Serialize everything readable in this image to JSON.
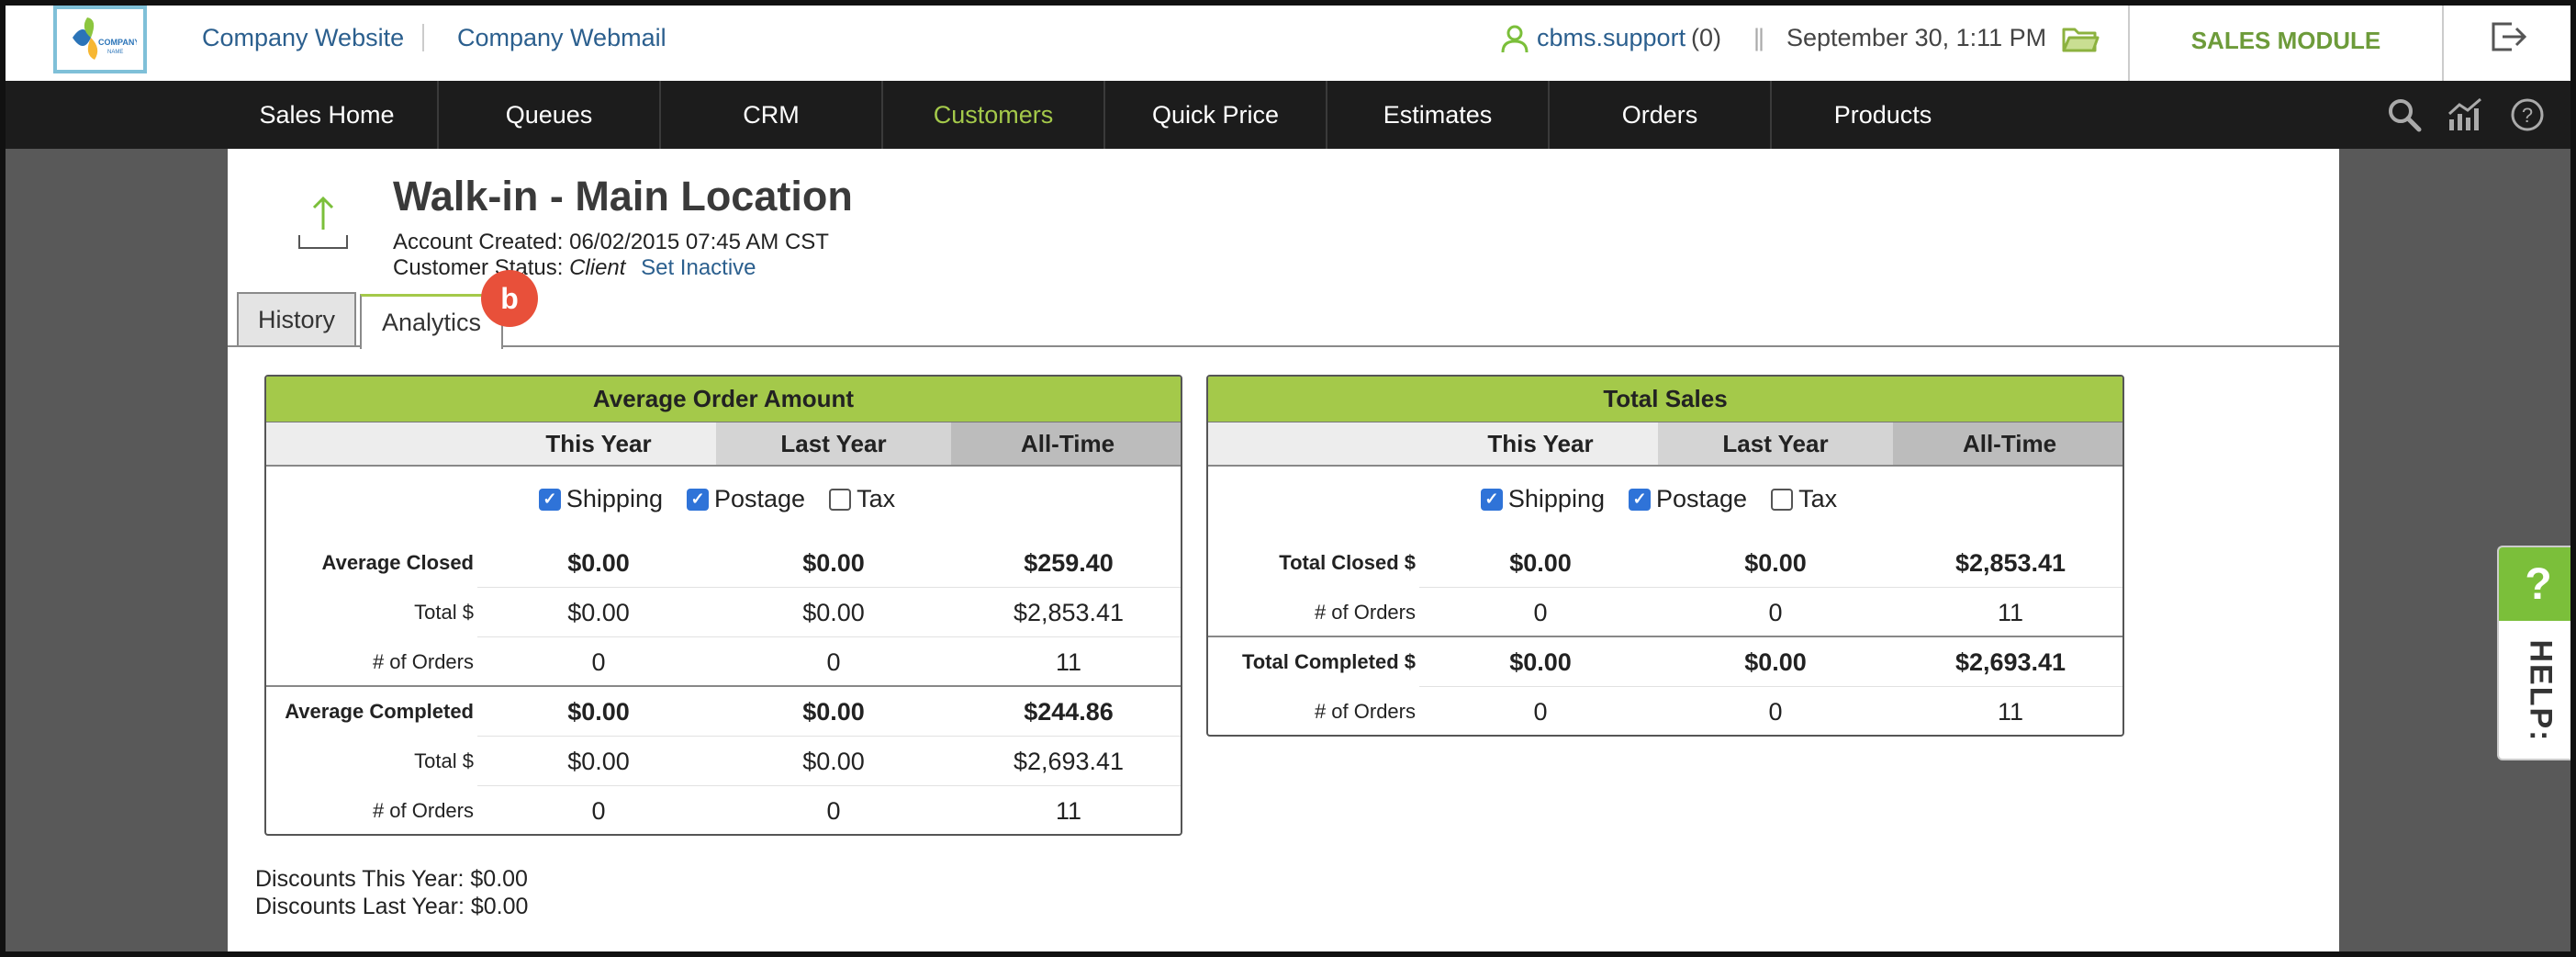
{
  "topbar": {
    "logo_alt": "COMPANY NAME",
    "company_website": "Company Website",
    "company_webmail": "Company Webmail",
    "user_name": "cbms.support",
    "user_count": "(0)",
    "pipe": "||",
    "datetime": "September 30, 1:11 PM",
    "module": "SALES MODULE"
  },
  "nav": {
    "items": [
      "Sales Home",
      "Queues",
      "CRM",
      "Customers",
      "Quick Price",
      "Estimates",
      "Orders",
      "Products"
    ],
    "active": "Customers"
  },
  "customer": {
    "title": "Walk-in - Main Location",
    "account_created_label": "Account Created:",
    "account_created_value": "06/02/2015 07:45 AM CST",
    "status_label": "Customer Status:",
    "status_value": "Client",
    "set_inactive": "Set Inactive"
  },
  "tabs": {
    "history": "History",
    "analytics": "Analytics",
    "badge": "b"
  },
  "avg_panel": {
    "title": "Average Order Amount",
    "columns": [
      "This Year",
      "Last Year",
      "All-Time"
    ],
    "checks": [
      {
        "label": "Shipping",
        "checked": true
      },
      {
        "label": "Postage",
        "checked": true
      },
      {
        "label": "Tax",
        "checked": false
      }
    ],
    "rows": [
      {
        "label": "Average Closed",
        "values": [
          "$0.00",
          "$0.00",
          "$259.40"
        ]
      },
      {
        "label": "Total $",
        "values": [
          "$0.00",
          "$0.00",
          "$2,853.41"
        ]
      },
      {
        "label": "# of Orders",
        "values": [
          "0",
          "0",
          "11"
        ]
      },
      {
        "label": "Average Completed",
        "values": [
          "$0.00",
          "$0.00",
          "$244.86"
        ]
      },
      {
        "label": "Total $",
        "values": [
          "$0.00",
          "$0.00",
          "$2,693.41"
        ]
      },
      {
        "label": "# of Orders",
        "values": [
          "0",
          "0",
          "11"
        ]
      }
    ]
  },
  "total_panel": {
    "title": "Total Sales",
    "columns": [
      "This Year",
      "Last Year",
      "All-Time"
    ],
    "checks": [
      {
        "label": "Shipping",
        "checked": true
      },
      {
        "label": "Postage",
        "checked": true
      },
      {
        "label": "Tax",
        "checked": false
      }
    ],
    "rows": [
      {
        "label": "Total Closed $",
        "values": [
          "$0.00",
          "$0.00",
          "$2,853.41"
        ]
      },
      {
        "label": "# of Orders",
        "values": [
          "0",
          "0",
          "11"
        ]
      },
      {
        "label": "Total Completed $",
        "values": [
          "$0.00",
          "$0.00",
          "$2,693.41"
        ]
      },
      {
        "label": "# of Orders",
        "values": [
          "0",
          "0",
          "11"
        ]
      }
    ]
  },
  "discounts": {
    "this_year": "Discounts This Year: $0.00",
    "last_year": "Discounts Last Year: $0.00"
  },
  "help": {
    "q": "?",
    "label": "HELP:"
  },
  "colors": {
    "accent_green": "#a4c94a",
    "link_blue": "#2b5f8e",
    "nav_bg": "#1c1c1c",
    "badge_red": "#e8503a"
  }
}
